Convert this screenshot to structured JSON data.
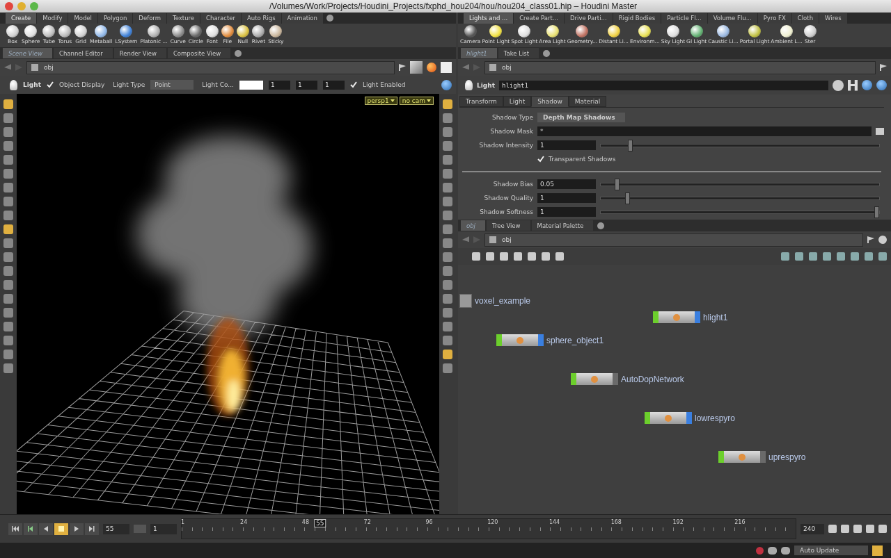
{
  "window": {
    "title": "/Volumes/Work/Projects/Houdini_Projects/fxphd_hou204/hou/hou204_class01.hip – Houdini Master"
  },
  "left_shelf": {
    "tabs": [
      {
        "label": "Create",
        "selected": true
      },
      {
        "label": "Modify",
        "selected": false
      },
      {
        "label": "Model",
        "selected": false
      },
      {
        "label": "Polygon",
        "selected": false
      },
      {
        "label": "Deform",
        "selected": false
      },
      {
        "label": "Texture",
        "selected": false
      },
      {
        "label": "Character",
        "selected": false
      },
      {
        "label": "Auto Rigs",
        "selected": false
      },
      {
        "label": "Animation",
        "selected": false
      }
    ],
    "tools": [
      "Box",
      "Sphere",
      "Tube",
      "Torus",
      "Grid",
      "Metaball",
      "LSystem",
      "Platonic ...",
      "Curve",
      "Circle",
      "Font",
      "File",
      "Null",
      "Rivet",
      "Sticky"
    ]
  },
  "right_shelf": {
    "tabs": [
      {
        "label": "Lights and ...",
        "selected": true
      },
      {
        "label": "Create Part...",
        "selected": false
      },
      {
        "label": "Drive Parti...",
        "selected": false
      },
      {
        "label": "Rigid Bodies",
        "selected": false
      },
      {
        "label": "Particle Fl...",
        "selected": false
      },
      {
        "label": "Volume Flu...",
        "selected": false
      },
      {
        "label": "Pyro FX",
        "selected": false
      },
      {
        "label": "Cloth",
        "selected": false
      },
      {
        "label": "Wires",
        "selected": false
      }
    ],
    "tools": [
      "Camera",
      "Point Light",
      "Spot Light",
      "Area Light",
      "Geometry...",
      "Distant Li...",
      "Environm...",
      "Sky Light",
      "GI Light",
      "Caustic Li...",
      "Portal Light",
      "Ambient L...",
      "Ster"
    ]
  },
  "scene_view": {
    "tabs": [
      {
        "label": "Scene View",
        "selected": true
      },
      {
        "label": "Channel Editor",
        "selected": false
      },
      {
        "label": "Render View",
        "selected": false
      },
      {
        "label": "Composite View",
        "selected": false
      }
    ],
    "path": "obj",
    "toolbar": {
      "node_type": "Light",
      "object_display": {
        "label": "Object Display",
        "checked": true
      },
      "light_type_label": "Light Type",
      "light_type": "Point",
      "color_label": "Light Co...",
      "color_values": [
        "1",
        "1",
        "1"
      ],
      "light_enabled": {
        "label": "Light Enabled",
        "checked": true
      }
    },
    "camera_menu": "persp1",
    "camera_lock_menu": "no cam"
  },
  "parameters": {
    "tabs": [
      {
        "label": "hlight1",
        "selected": true
      },
      {
        "label": "Take List",
        "selected": false
      }
    ],
    "path": "obj",
    "node_type": "Light",
    "node_name": "hlight1",
    "sections": [
      {
        "label": "Transform",
        "selected": false
      },
      {
        "label": "Light",
        "selected": false
      },
      {
        "label": "Shadow",
        "selected": true
      },
      {
        "label": "Material",
        "selected": false
      }
    ],
    "rows": [
      {
        "kind": "menu",
        "label": "Shadow Type",
        "value": "Depth Map Shadows"
      },
      {
        "kind": "text",
        "label": "Shadow Mask",
        "value": "*"
      },
      {
        "kind": "slider",
        "label": "Shadow Intensity",
        "value": "1",
        "level": 0.1
      },
      {
        "kind": "checkbox",
        "label": "Transparent Shadows",
        "checked": true
      },
      {
        "kind": "separator"
      },
      {
        "kind": "slider",
        "label": "Shadow Bias",
        "value": "0.05",
        "level": 0.05
      },
      {
        "kind": "slider",
        "label": "Shadow Quality",
        "value": "1",
        "level": 0.09
      },
      {
        "kind": "slider",
        "label": "Shadow Softness",
        "value": "1",
        "level": 1
      }
    ]
  },
  "network": {
    "tabs": [
      {
        "label": "obj",
        "selected": true
      },
      {
        "label": "Tree View",
        "selected": false
      },
      {
        "label": "Material Palette",
        "selected": false
      }
    ],
    "path": "obj",
    "nodes": [
      {
        "kind": "subnet",
        "name": "voxel_example"
      },
      {
        "kind": "object",
        "name": "hlight1",
        "display": true,
        "render": true
      },
      {
        "kind": "object",
        "name": "sphere_object1",
        "display": true,
        "render": true
      },
      {
        "kind": "object",
        "name": "AutoDopNetwork",
        "display": true,
        "render": false
      },
      {
        "kind": "object",
        "name": "lowrespyro",
        "display": true,
        "render": true
      },
      {
        "kind": "object",
        "name": "uprespyro",
        "display": true,
        "render": false
      }
    ]
  },
  "timeline": {
    "current_frame": "55",
    "step": "1",
    "end_frame": "240",
    "ticks": [
      "1",
      "24",
      "48",
      "72",
      "96",
      "120",
      "144",
      "168",
      "192",
      "216"
    ],
    "marker": "55",
    "level": 0.226
  },
  "status_bar": {
    "update_mode": "Auto Update"
  }
}
